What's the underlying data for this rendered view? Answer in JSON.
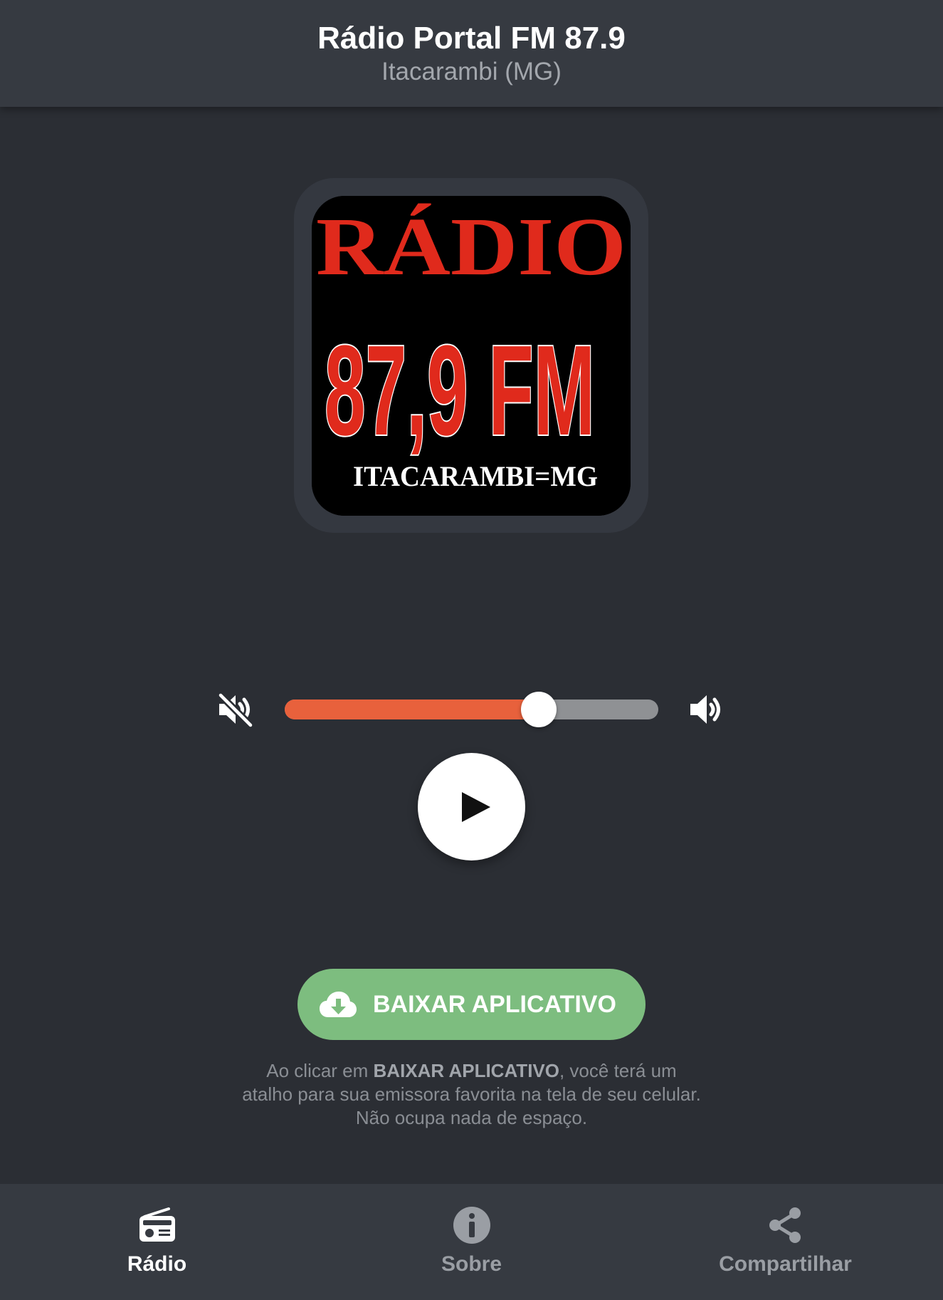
{
  "header": {
    "title": "Rádio Portal FM 87.9",
    "subtitle": "Itacarambi (MG)"
  },
  "logo": {
    "line1": "RÁDIO",
    "line2": "87,9 FM",
    "line3": "ITACARAMBI=MG",
    "colors": {
      "background": "#000000",
      "text_red": "#e02a1c",
      "text_white": "#ffffff"
    }
  },
  "player": {
    "volume_level": 0.68,
    "mute_icon": "volume-mute-icon",
    "max_icon": "volume-up-icon",
    "play_icon": "play-icon",
    "colors": {
      "volume_fill": "#e8613c",
      "volume_track": "#8f9194"
    }
  },
  "download": {
    "label": "BAIXAR APLICATIVO",
    "icon": "cloud-download-icon",
    "color": "#7dbd7f",
    "note_prefix": "Ao clicar em ",
    "note_bold": "BAIXAR APLICATIVO",
    "note_suffix": ", você terá um atalho para sua emissora favorita na tela de seu celular. Não ocupa nada de espaço."
  },
  "nav": {
    "items": [
      {
        "label": "Rádio",
        "icon": "radio-icon",
        "active": true,
        "color": "#ffffff"
      },
      {
        "label": "Sobre",
        "icon": "info-icon",
        "active": false,
        "color": "#9a9ea4"
      },
      {
        "label": "Compartilhar",
        "icon": "share-icon",
        "active": false,
        "color": "#9a9ea4"
      }
    ]
  }
}
